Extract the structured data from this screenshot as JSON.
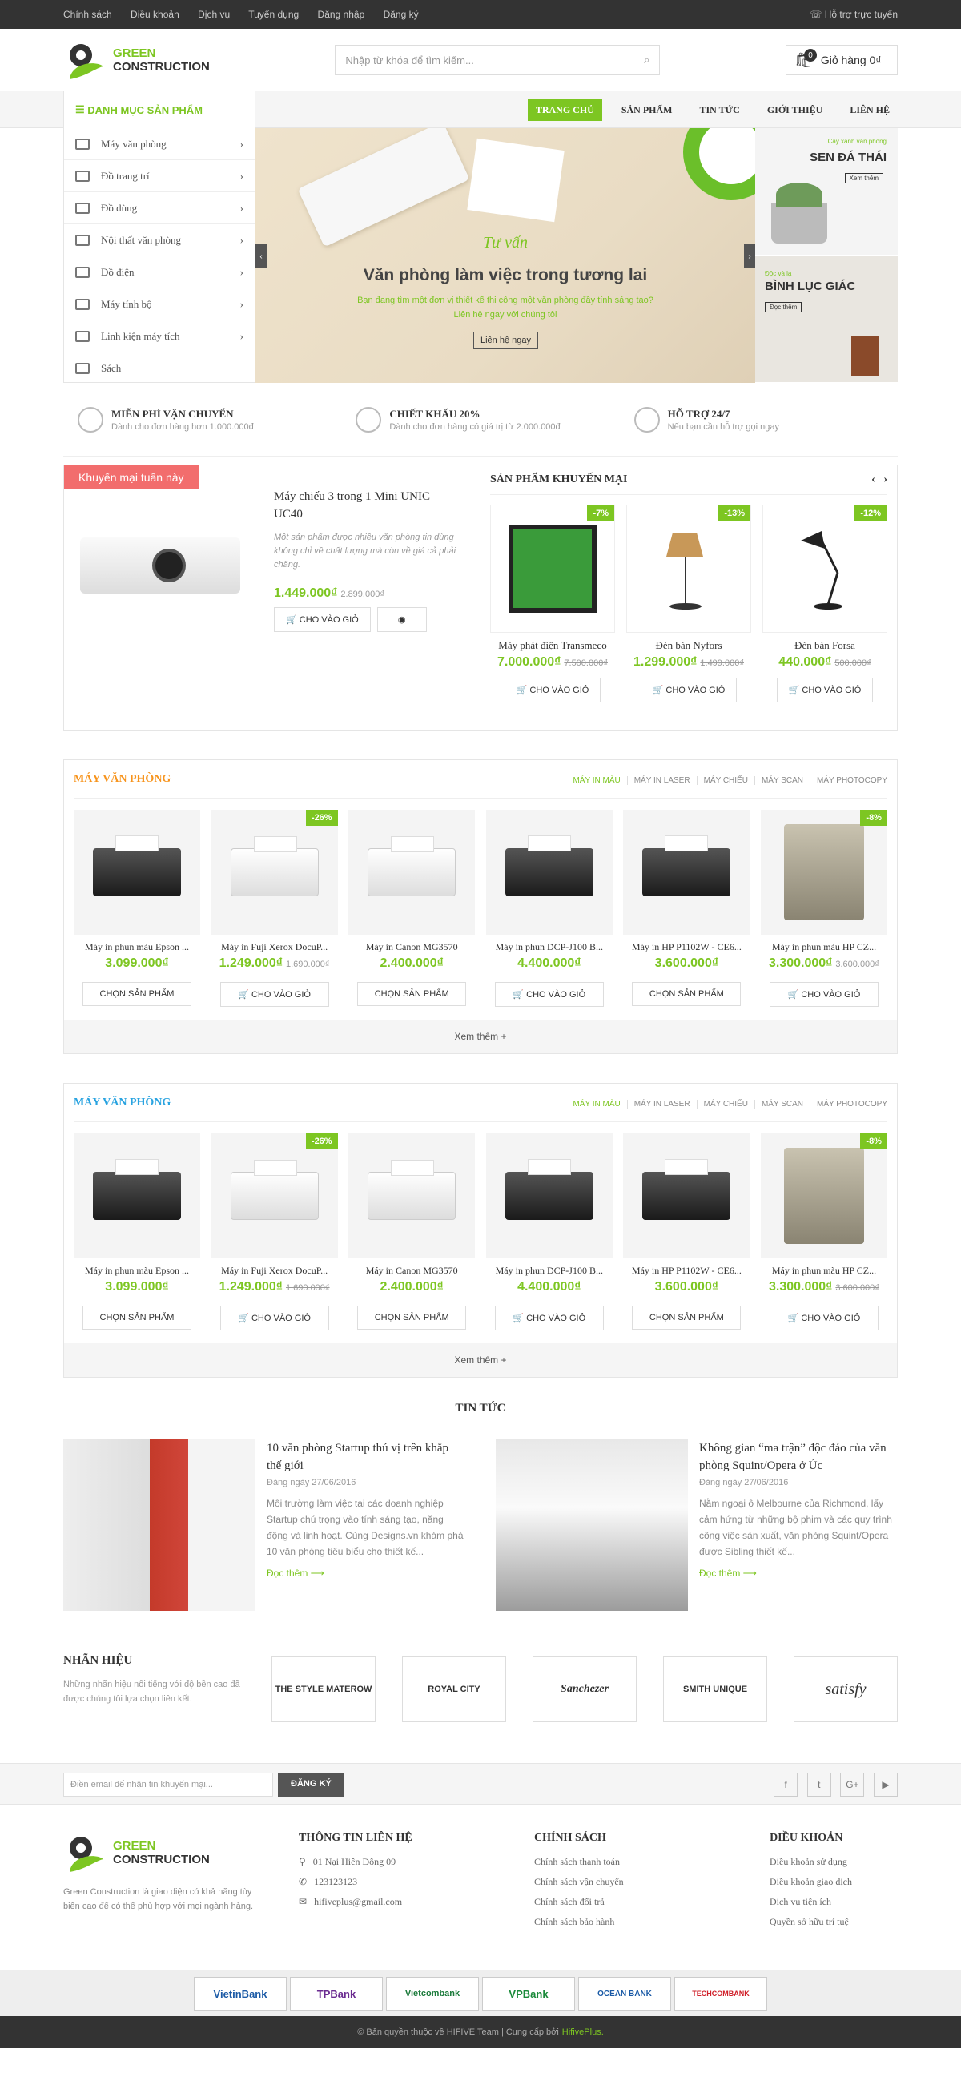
{
  "topbar": {
    "links": [
      "Chính sách",
      "Điều khoản",
      "Dịch vụ",
      "Tuyển dụng",
      "Đăng nhập",
      "Đăng ký"
    ],
    "support": "Hỗ trợ trực tuyến"
  },
  "brand": {
    "line1": "GREEN",
    "line2": "CONSTRUCTION",
    "accent": "#7dc622"
  },
  "search": {
    "placeholder": "Nhập từ khóa để tìm kiếm..."
  },
  "cart": {
    "label": "Giỏ hàng 0₫",
    "count": "0"
  },
  "nav": {
    "category_label": "DANH MỤC SẢN PHẨM",
    "menu": [
      "TRANG CHỦ",
      "SẢN PHẨM",
      "TIN TỨC",
      "GIỚI THIỆU",
      "LIÊN HỆ"
    ]
  },
  "sidebar": {
    "items": [
      {
        "label": "Máy văn phòng"
      },
      {
        "label": "Đồ trang trí"
      },
      {
        "label": "Đồ dùng"
      },
      {
        "label": "Nội thất văn phòng"
      },
      {
        "label": "Đồ điện"
      },
      {
        "label": "Máy tính bộ"
      },
      {
        "label": "Linh kiện máy tích"
      },
      {
        "label": "Sách"
      }
    ]
  },
  "slider": {
    "script": "Tư vấn",
    "title": "Văn phòng làm việc trong tương lai",
    "line1": "Bạn đang tìm một đơn vị thiết kế thi công một văn phòng đầy tính sáng tạo?",
    "line2": "Liên hệ ngay với chúng tôi",
    "button": "Liên hệ ngay"
  },
  "banners": [
    {
      "small": "Cây xanh văn phòng",
      "title": "SEN ĐÁ THÁI",
      "button": "Xem thêm"
    },
    {
      "small": "Độc và lạ",
      "title": "BÌNH LỤC GIÁC",
      "button": "Đọc thêm"
    }
  ],
  "features": [
    {
      "title": "MIỄN PHÍ VẬN CHUYỂN",
      "sub": "Dành cho đơn hàng hơn 1.000.000đ"
    },
    {
      "title": "CHIẾT KHẤU 20%",
      "sub": "Dành cho đơn hàng có giá trị từ 2.000.000đ"
    },
    {
      "title": "HỖ TRỢ 24/7",
      "sub": "Nếu bạn cần hỗ trợ gọi ngay"
    }
  ],
  "weekly": {
    "ribbon": "Khuyến mại tuần này",
    "name": "Máy chiếu 3 trong 1 Mini UNIC UC40",
    "desc": "Một sản phẩm được nhiều văn phòng tin dùng không chỉ về chất lượng mà còn về giá cả phải chăng.",
    "price": "1.449.000₫",
    "old": "2.899.000₫",
    "cart": "CHO VÀO GIỎ",
    "view": "◉"
  },
  "promo": {
    "title": "SẢN PHẨM KHUYẾN MẠI",
    "items": [
      {
        "name": "Máy phát điện Transmeco",
        "price": "7.000.000₫",
        "old": "7.500.000₫",
        "tag": "-7%",
        "cart": "CHO VÀO GIỎ"
      },
      {
        "name": "Đèn bàn Nyfors",
        "price": "1.299.000₫",
        "old": "1.499.000₫",
        "tag": "-13%",
        "cart": "CHO VÀO GIỎ"
      },
      {
        "name": "Đèn bàn Forsa",
        "price": "440.000₫",
        "old": "500.000₫",
        "tag": "-12%",
        "cart": "CHO VÀO GIỎ"
      }
    ]
  },
  "blocks": [
    {
      "title": "MÁY VĂN PHÒNG",
      "title_color": "#f7941d",
      "tabs": [
        "MÁY IN MÀU",
        "MÁY IN LASER",
        "MÁY CHIẾU",
        "MÁY SCAN",
        "MÁY PHOTOCOPY"
      ],
      "more": "Xem thêm +",
      "products": [
        {
          "name": "Máy in phun màu Epson ...",
          "price": "3.099.000₫",
          "old": "",
          "tag": "",
          "btn": "CHỌN SẢN PHẨM"
        },
        {
          "name": "Máy in Fuji Xerox DocuP...",
          "price": "1.249.000₫",
          "old": "1.690.000₫",
          "tag": "-26%",
          "btn": "CHO VÀO GIỎ"
        },
        {
          "name": "Máy in Canon MG3570",
          "price": "2.400.000₫",
          "old": "",
          "tag": "",
          "btn": "CHỌN SẢN PHẨM"
        },
        {
          "name": "Máy in phun DCP-J100 B...",
          "price": "4.400.000₫",
          "old": "",
          "tag": "",
          "btn": "CHO VÀO GIỎ"
        },
        {
          "name": "Máy in HP P1102W - CE6...",
          "price": "3.600.000₫",
          "old": "",
          "tag": "",
          "btn": "CHỌN SẢN PHẨM"
        },
        {
          "name": "Máy in phun màu HP CZ...",
          "price": "3.300.000₫",
          "old": "3.600.000₫",
          "tag": "-8%",
          "btn": "CHO VÀO GIỎ"
        }
      ]
    },
    {
      "title": "MÁY VĂN PHÒNG",
      "title_color": "#29a3e0",
      "tabs": [
        "MÁY IN MÀU",
        "MÁY IN LASER",
        "MÁY CHIẾU",
        "MÁY SCAN",
        "MÁY PHOTOCOPY"
      ],
      "more": "Xem thêm +",
      "products": [
        {
          "name": "Máy in phun màu Epson ...",
          "price": "3.099.000₫",
          "old": "",
          "tag": "",
          "btn": "CHỌN SẢN PHẨM"
        },
        {
          "name": "Máy in Fuji Xerox DocuP...",
          "price": "1.249.000₫",
          "old": "1.690.000₫",
          "tag": "-26%",
          "btn": "CHO VÀO GIỎ"
        },
        {
          "name": "Máy in Canon MG3570",
          "price": "2.400.000₫",
          "old": "",
          "tag": "",
          "btn": "CHỌN SẢN PHẨM"
        },
        {
          "name": "Máy in phun DCP-J100 B...",
          "price": "4.400.000₫",
          "old": "",
          "tag": "",
          "btn": "CHO VÀO GIỎ"
        },
        {
          "name": "Máy in HP P1102W - CE6...",
          "price": "3.600.000₫",
          "old": "",
          "tag": "",
          "btn": "CHỌN SẢN PHẨM"
        },
        {
          "name": "Máy in phun màu HP CZ...",
          "price": "3.300.000₫",
          "old": "3.600.000₫",
          "tag": "-8%",
          "btn": "CHO VÀO GIỎ"
        }
      ]
    }
  ],
  "news": {
    "title": "TIN TỨC",
    "items": [
      {
        "title": "10 văn phòng Startup thú vị trên khắp thế giới",
        "date": "Đăng ngày 27/06/2016",
        "desc": "Môi trường làm việc tại các doanh nghiệp Startup chú trọng vào tính sáng tạo, năng động và linh hoạt. Cùng Designs.vn khám phá 10 văn phòng tiêu biểu cho thiết kế...",
        "more": "Đọc thêm ⟶"
      },
      {
        "title": "Không gian “ma trận” độc đáo của văn phòng Squint/Opera ở Úc",
        "date": "Đăng ngày 27/06/2016",
        "desc": "Nằm ngoại ô Melbourne của Richmond, lấy cảm hứng từ những bộ phim và các quy trình công việc sản xuất, văn phòng Squint/Opera được Sibling thiết kế...",
        "more": "Đọc thêm ⟶"
      }
    ]
  },
  "brands": {
    "title": "NHÃN HIỆU",
    "sub": "Những nhãn hiệu nổi tiếng với độ bền cao đã được chúng tôi lựa chọn liên kết.",
    "logos": [
      "THE STYLE MATEROW",
      "ROYAL CITY",
      "Sanchezer",
      "SMITH UNIQUE",
      "satisfy"
    ]
  },
  "newsletter": {
    "placeholder": "Điền email để nhận tin khuyến mại...",
    "button": "ĐĂNG KÝ",
    "social": [
      "f",
      "t",
      "G+",
      "▶"
    ]
  },
  "footer": {
    "desc": "Green Construction là giao diện có khả năng tùy biến cao để có thể phù hợp với mọi ngành hàng.",
    "cols": [
      {
        "title": "THÔNG TIN LIÊN HỆ",
        "items": [
          "01 Nại Hiên Đông 09",
          "123123123",
          "hifiveplus@gmail.com"
        ]
      },
      {
        "title": "CHÍNH SÁCH",
        "items": [
          "Chính sách thanh toán",
          "Chính sách vận chuyển",
          "Chính sách đổi trả",
          "Chính sách bảo hành"
        ]
      },
      {
        "title": "ĐIỀU KHOẢN",
        "items": [
          "Điều khoản sử dụng",
          "Điều khoản giao dịch",
          "Dịch vụ tiện ích",
          "Quyền sở hữu trí tuệ"
        ]
      }
    ]
  },
  "banks": [
    "VietinBank",
    "TPBank",
    "Vietcombank",
    "VPBank",
    "OCEAN BANK",
    "TECHCOMBANK"
  ],
  "copyright": {
    "text": "© Bản quyền thuộc về HIFIVE Team | Cung cấp bởi",
    "link": "HifivePlus."
  }
}
